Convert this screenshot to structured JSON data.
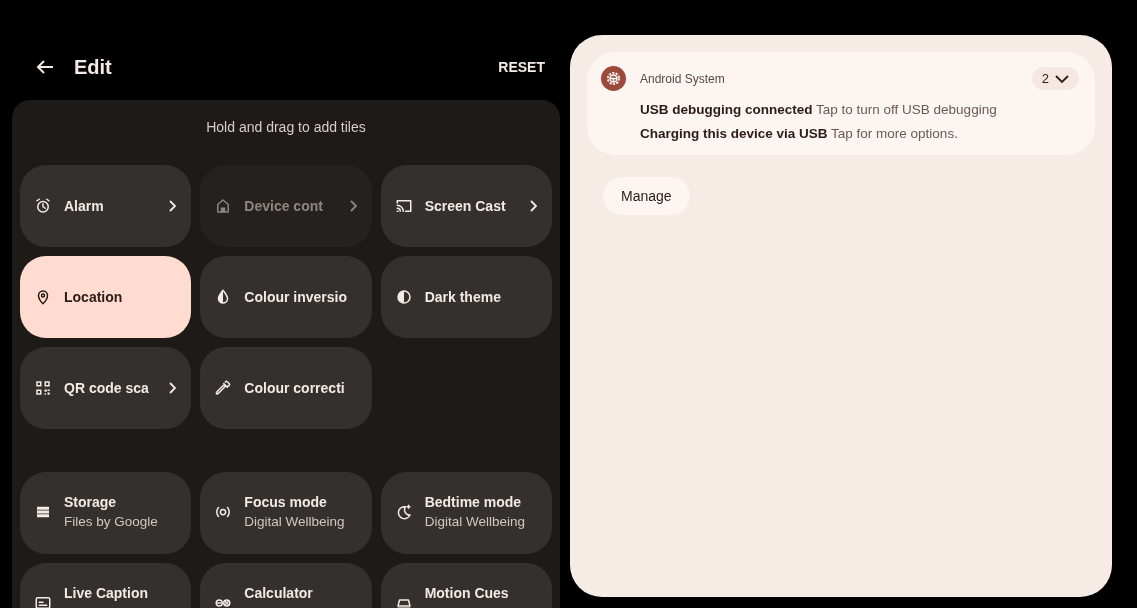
{
  "header": {
    "title": "Edit",
    "action": "RESET"
  },
  "tiles_hint": "Hold and drag to add tiles",
  "current_tiles": [
    {
      "kind": "alarm",
      "label": "Alarm",
      "chevron": true,
      "on": false,
      "disabled": false
    },
    {
      "kind": "home",
      "label": "Device cont",
      "chevron": true,
      "on": false,
      "disabled": true
    },
    {
      "kind": "cast",
      "label": "Screen Cast",
      "chevron": true,
      "on": false,
      "disabled": false
    },
    {
      "kind": "pin",
      "label": "Location",
      "chevron": false,
      "on": true,
      "disabled": false
    },
    {
      "kind": "drop",
      "label": "Colour inversio",
      "chevron": false,
      "on": false,
      "disabled": false
    },
    {
      "kind": "half",
      "label": "Dark theme",
      "chevron": false,
      "on": false,
      "disabled": false
    },
    {
      "kind": "qr",
      "label": "QR code sca",
      "chevron": true,
      "on": false,
      "disabled": false
    },
    {
      "kind": "dropper",
      "label": "Colour correcti",
      "chevron": false,
      "on": false,
      "disabled": false
    }
  ],
  "available_tiles": [
    {
      "kind": "storage",
      "label": "Storage",
      "sublabel": "Files by Google"
    },
    {
      "kind": "focus",
      "label": "Focus mode",
      "sublabel": "Digital Wellbeing"
    },
    {
      "kind": "moon",
      "label": "Bedtime mode",
      "sublabel": "Digital Wellbeing"
    },
    {
      "kind": "caption",
      "label": "Live Caption"
    },
    {
      "kind": "calc",
      "label": "Calculator"
    },
    {
      "kind": "motion",
      "label": "Motion Cues"
    }
  ],
  "notification": {
    "app": "Android System",
    "count": "2",
    "expanded": false,
    "messages": [
      "**USB debugging connected** Tap to turn off USB debugging",
      "**Charging this device via USB** Tap for more options."
    ]
  },
  "manage_button": "Manage"
}
